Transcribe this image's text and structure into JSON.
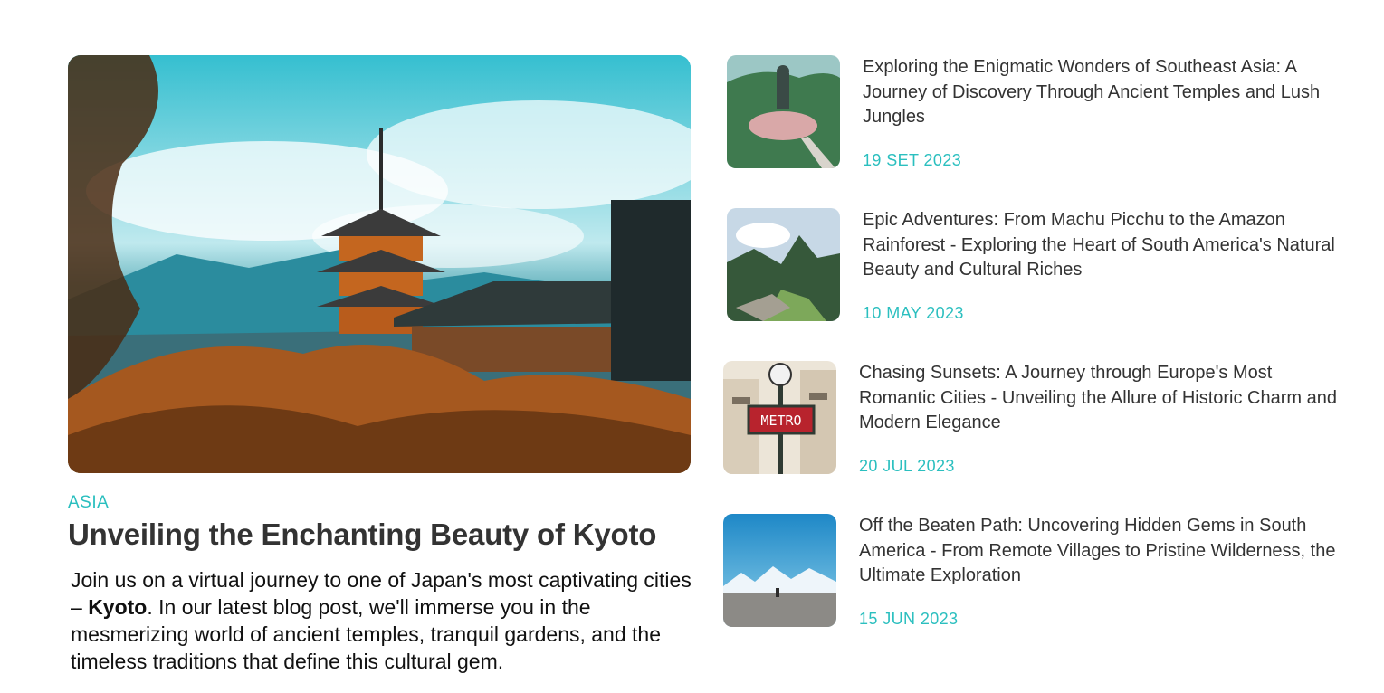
{
  "featured": {
    "image_alt": "Kyoto pagoda and temple",
    "category": "ASIA",
    "title": "Unveiling the Enchanting Beauty of Kyoto",
    "excerpt_before": "Join us on a virtual journey to one of Japan's most captivating cities – ",
    "excerpt_bold": "Kyoto",
    "excerpt_after": ". In our latest blog post, we'll immerse you in the mesmerizing world of ancient temples, tranquil gardens, and the timeless traditions that define this cultural gem."
  },
  "posts": [
    {
      "title": "Exploring the Enigmatic Wonders of Southeast Asia: A Journey of Discovery Through Ancient Temples and Lush Jungles",
      "date": "19 SET 2023"
    },
    {
      "title": "Epic Adventures: From Machu Picchu to the Amazon Rainforest - Exploring the Heart of South America's Natural Beauty and Cultural Riches",
      "date": "10 MAY 2023"
    },
    {
      "title": "Chasing Sunsets: A Journey through Europe's Most Romantic Cities - Unveiling the Allure of Historic Charm and Modern Elegance",
      "date": "20 JUL 2023",
      "sign_text": "METRO"
    },
    {
      "title": "Off the Beaten Path: Uncovering Hidden Gems in South America - From Remote Villages to Pristine Wilderness, the Ultimate Exploration",
      "date": "15 JUN 2023"
    }
  ],
  "colors": {
    "accent": "#2bbfbf",
    "title": "#333333"
  }
}
